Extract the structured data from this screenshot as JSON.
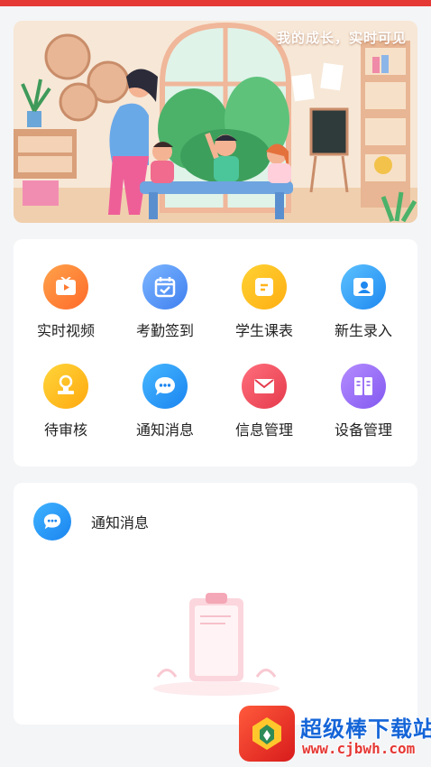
{
  "banner": {
    "title": "我的成长，实时可见"
  },
  "menu": [
    {
      "label": "实时视频",
      "icon": "video-icon",
      "color_from": "#ffa24a",
      "color_to": "#ff6a2a"
    },
    {
      "label": "考勤签到",
      "icon": "calendar-check-icon",
      "color_from": "#7cb6ff",
      "color_to": "#3f7ff0"
    },
    {
      "label": "学生课表",
      "icon": "timetable-icon",
      "color_from": "#ffd233",
      "color_to": "#ffae12"
    },
    {
      "label": "新生录入",
      "icon": "user-card-icon",
      "color_from": "#5cc2ff",
      "color_to": "#1e88f0"
    },
    {
      "label": "待审核",
      "icon": "stamp-icon",
      "color_from": "#ffd53a",
      "color_to": "#ffa90f"
    },
    {
      "label": "通知消息",
      "icon": "chat-icon",
      "color_from": "#47b7ff",
      "color_to": "#1a84f0"
    },
    {
      "label": "信息管理",
      "icon": "mail-icon",
      "color_from": "#ff6f7c",
      "color_to": "#e53a4c"
    },
    {
      "label": "设备管理",
      "icon": "device-icon",
      "color_from": "#b58cff",
      "color_to": "#8258f0"
    }
  ],
  "notice": {
    "title": "通知消息",
    "icon": "chat-icon"
  },
  "watermark": {
    "name": "超级棒下载站",
    "url": "www.cjbwh.com"
  },
  "colors": {
    "accent_red": "#e53935",
    "background": "#f4f5f7",
    "card": "#ffffff"
  }
}
